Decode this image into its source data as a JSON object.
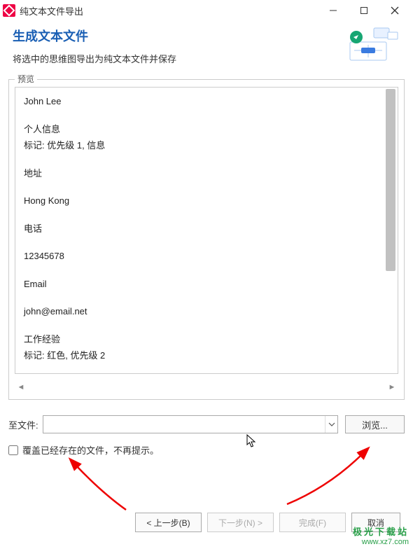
{
  "window": {
    "title": "纯文本文件导出"
  },
  "header": {
    "title": "生成文本文件",
    "subtitle": "将选中的思维图导出为纯文本文件并保存"
  },
  "preview": {
    "legend": "预览",
    "lines": [
      "John Lee",
      "",
      "个人信息",
      "标记: 优先级 1, 信息",
      "",
      "地址",
      "",
      "Hong Kong",
      "",
      "电话",
      "",
      "12345678",
      "",
      "Email",
      "",
      "john@email.net",
      "",
      "工作经验",
      "标记: 红色, 优先级 2"
    ]
  },
  "file": {
    "label": "至文件:",
    "value": "",
    "browse": "浏览..."
  },
  "overwrite": {
    "label": "覆盖已经存在的文件，不再提示。",
    "checked": false
  },
  "buttons": {
    "prev": "< 上一步(B)",
    "next": "下一步(N) >",
    "finish": "完成(F)",
    "cancel": "取消"
  },
  "watermark": {
    "line1": "极光下载站",
    "line2": "www.xz7.com"
  }
}
